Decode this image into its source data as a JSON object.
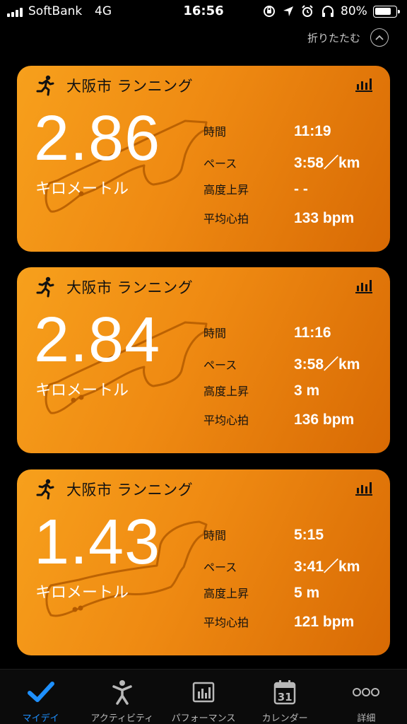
{
  "status_bar": {
    "carrier": "SoftBank",
    "network": "4G",
    "time": "16:56",
    "battery": "80%"
  },
  "header": {
    "collapse_label": "折りたたむ"
  },
  "activities": [
    {
      "title": "大阪市 ランニング",
      "distance": "2.86",
      "unit": "キロメートル",
      "stats": [
        {
          "label": "時間",
          "value": "11:19"
        },
        {
          "label": "ペース",
          "value": "3:58／km"
        },
        {
          "label": "高度上昇",
          "value": "- -"
        },
        {
          "label": "平均心拍",
          "value": "133 bpm"
        }
      ]
    },
    {
      "title": "大阪市 ランニング",
      "distance": "2.84",
      "unit": "キロメートル",
      "stats": [
        {
          "label": "時間",
          "value": "11:16"
        },
        {
          "label": "ペース",
          "value": "3:58／km"
        },
        {
          "label": "高度上昇",
          "value": "3 m"
        },
        {
          "label": "平均心拍",
          "value": "136 bpm"
        }
      ]
    },
    {
      "title": "大阪市 ランニング",
      "distance": "1.43",
      "unit": "キロメートル",
      "stats": [
        {
          "label": "時間",
          "value": "5:15"
        },
        {
          "label": "ペース",
          "value": "3:41／km"
        },
        {
          "label": "高度上昇",
          "value": "5 m"
        },
        {
          "label": "平均心拍",
          "value": "121 bpm"
        }
      ]
    }
  ],
  "tab_bar": {
    "tabs": [
      {
        "label": "マイデイ",
        "icon": "checkmark-icon",
        "active": true
      },
      {
        "label": "アクティビティ",
        "icon": "person-activity-icon",
        "active": false
      },
      {
        "label": "パフォーマンス",
        "icon": "performance-chart-icon",
        "active": false
      },
      {
        "label": "カレンダー",
        "icon": "calendar-icon",
        "calendar_day": "31",
        "active": false
      },
      {
        "label": "詳細",
        "icon": "more-icon",
        "active": false
      }
    ]
  },
  "colors": {
    "accent": "#1e90ff",
    "card_start": "#f7a01c",
    "card_end": "#d86a04",
    "route": "#b35a00"
  }
}
